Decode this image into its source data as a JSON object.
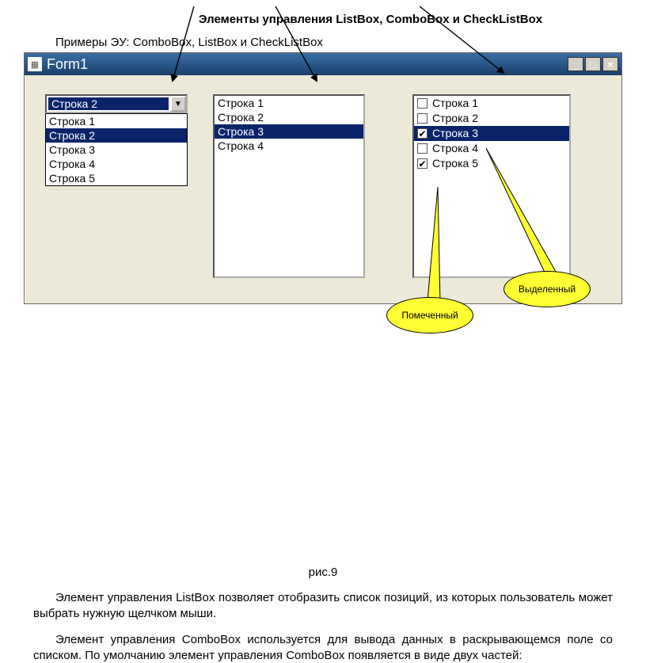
{
  "heading": "Элементы управления ListBox, ComboBox и CheckListBox",
  "examples_line": "Примеры ЭУ: ComboBox, ListBox и CheckListBox",
  "window": {
    "title": "Form1",
    "combo": {
      "selected": "Строка 2",
      "options": [
        "Строка 1",
        "Строка 2",
        "Строка 3",
        "Строка 4",
        "Строка 5"
      ],
      "open_selected_index": 1
    },
    "listbox": {
      "items": [
        "Строка 1",
        "Строка 2",
        "Строка 3",
        "Строка 4"
      ],
      "selected_index": 2
    },
    "checklist": {
      "items": [
        {
          "label": "Строка 1",
          "checked": false,
          "selected": false
        },
        {
          "label": "Строка 2",
          "checked": false,
          "selected": false
        },
        {
          "label": "Строка 3",
          "checked": true,
          "selected": true
        },
        {
          "label": "Строка 4",
          "checked": false,
          "selected": false
        },
        {
          "label": "Строка 5",
          "checked": true,
          "selected": false
        }
      ]
    }
  },
  "callouts": {
    "marked": "Помеченный",
    "selected": "Выделенный"
  },
  "figure_caption": "рис.9",
  "paragraph1": "Элемент управления ListBox позволяет отобразить список позиций, из которых пользователь может выбрать нужную щелчком мыши.",
  "paragraph2": "Элемент управления ComboBox используется для вывода данных в раскрывающемся поле со списком. По умолчанию элемент управления ComboBox появляется в виде двух частей:"
}
